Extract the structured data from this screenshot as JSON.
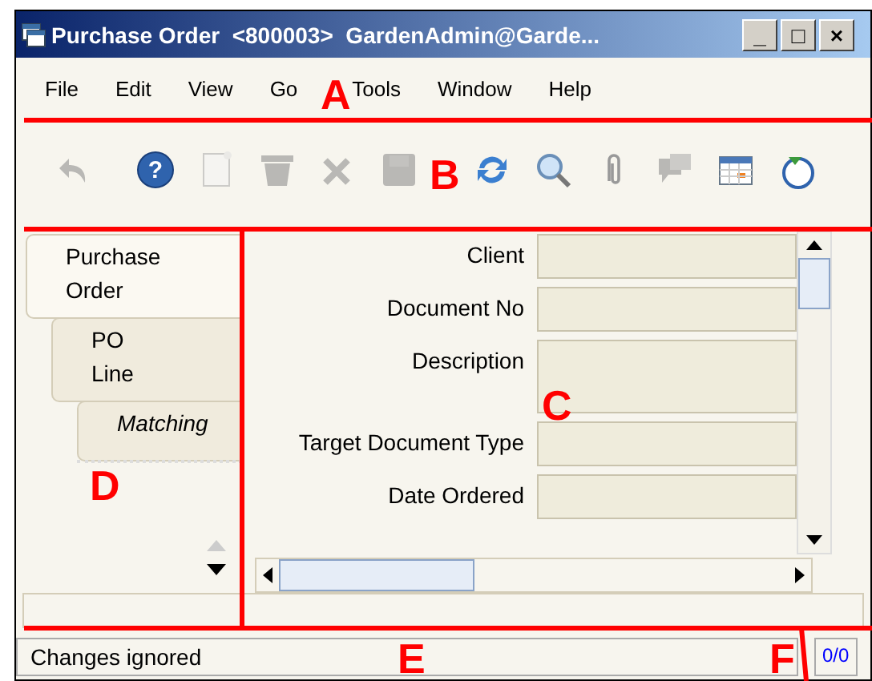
{
  "window": {
    "title": "Purchase Order  <800003>  GardenAdmin@Garde...",
    "controls": [
      "_",
      "□",
      "×"
    ]
  },
  "menu": [
    "File",
    "Edit",
    "View",
    "Go",
    "Tools",
    "Window",
    "Help"
  ],
  "toolbar": [
    {
      "kind": "undo",
      "disabled": true
    },
    {
      "kind": "help",
      "disabled": false,
      "symbol": "?"
    },
    {
      "kind": "new",
      "disabled": true
    },
    {
      "kind": "delete",
      "disabled": true
    },
    {
      "kind": "ignore",
      "disabled": true
    },
    {
      "kind": "save",
      "disabled": true
    },
    {
      "kind": "refresh",
      "disabled": false
    },
    {
      "kind": "find",
      "disabled": false
    },
    {
      "kind": "attach",
      "disabled": false
    },
    {
      "kind": "chat",
      "disabled": true
    },
    {
      "kind": "calendar",
      "disabled": false
    },
    {
      "kind": "history",
      "disabled": false
    }
  ],
  "tabs": [
    {
      "label": "Purchase\nOrder",
      "selected": true,
      "italic": false,
      "children": [
        {
          "label": "PO\nLine",
          "selected": false,
          "italic": false,
          "children": [
            {
              "label": "Matching",
              "selected": false,
              "italic": true
            }
          ]
        }
      ]
    }
  ],
  "form": {
    "fields": [
      {
        "label": "Client",
        "kind": "text"
      },
      {
        "label": "Document No",
        "kind": "text"
      },
      {
        "label": "Description",
        "kind": "textarea"
      },
      {
        "label": "Target Document Type",
        "kind": "text"
      },
      {
        "label": "Date Ordered",
        "kind": "text"
      }
    ]
  },
  "status_bar": {
    "message": "Changes ignored",
    "record": "0/0"
  },
  "annotations": [
    "A",
    "B",
    "C",
    "D",
    "E",
    "F"
  ]
}
